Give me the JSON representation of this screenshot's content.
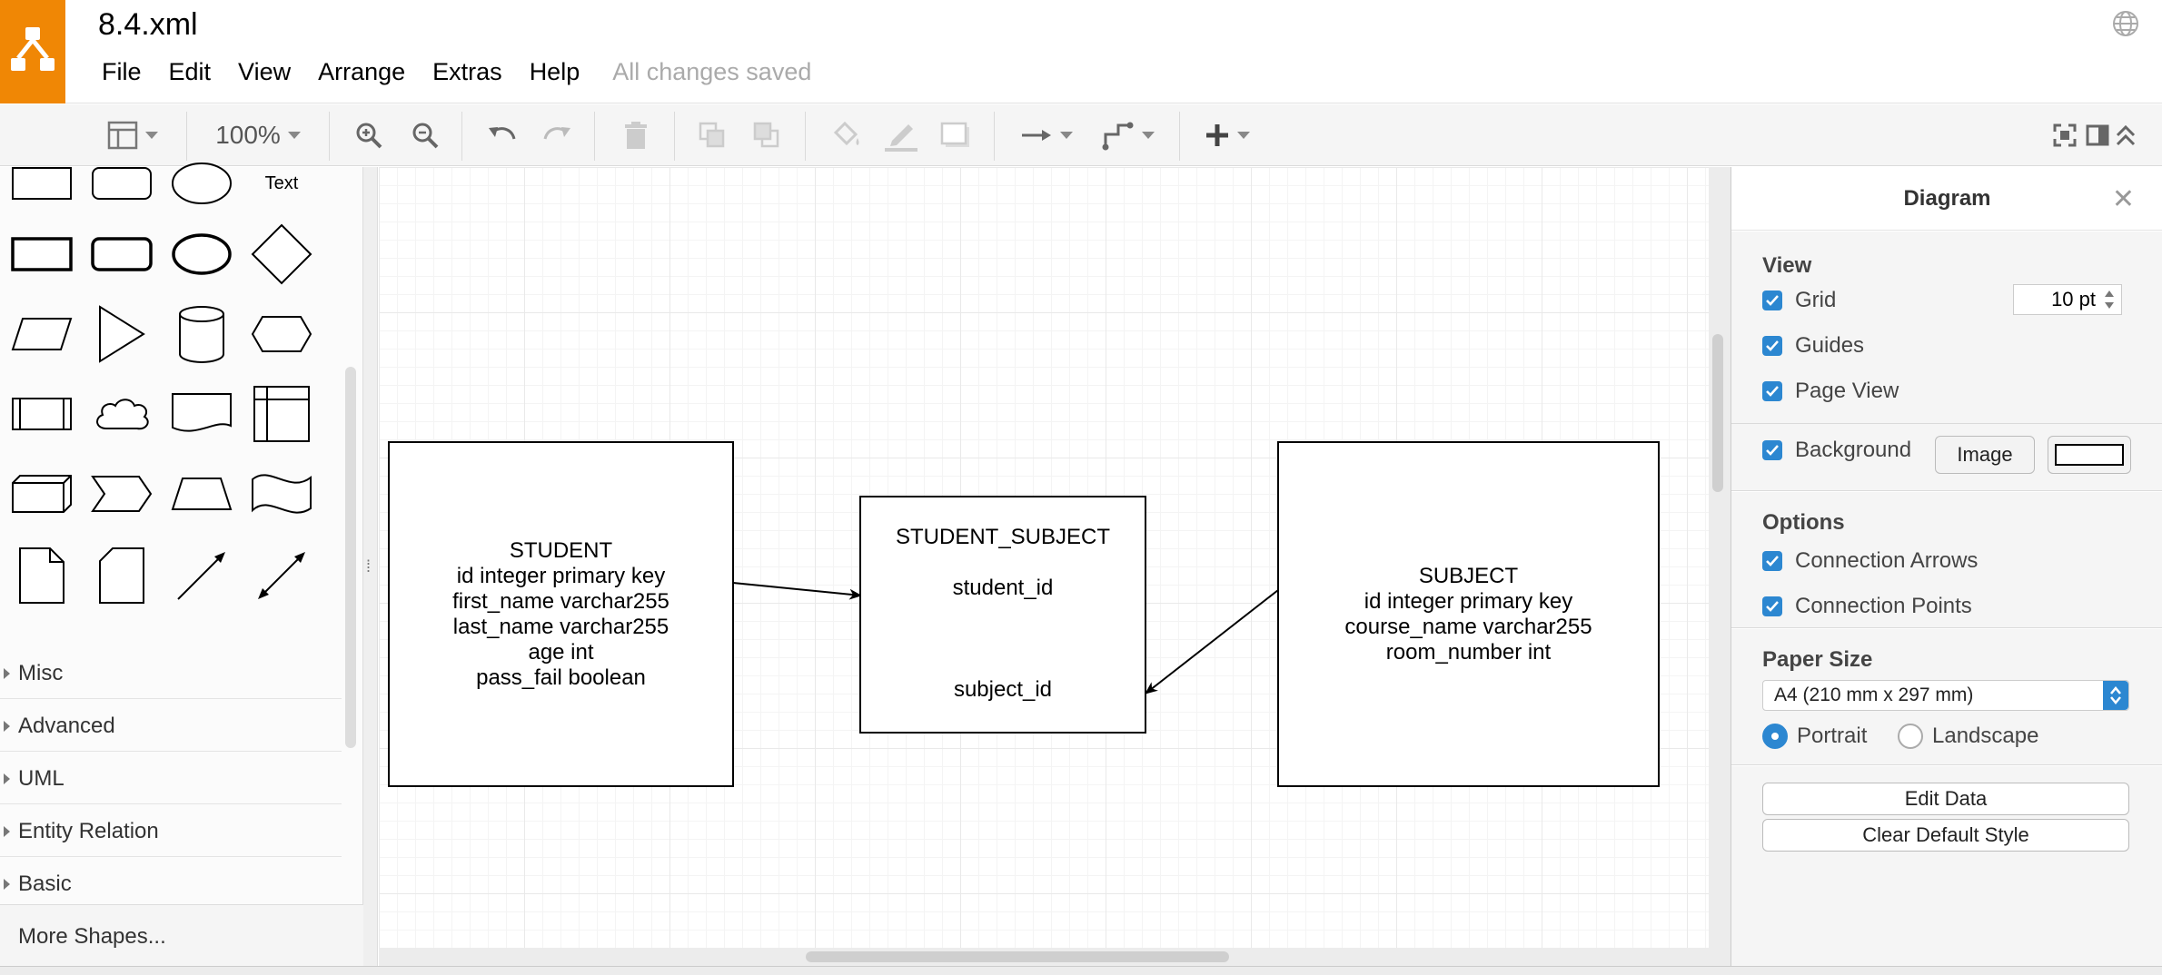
{
  "header": {
    "title": "8.4.xml",
    "menus": [
      "File",
      "Edit",
      "View",
      "Arrange",
      "Extras",
      "Help"
    ],
    "save_status": "All changes saved"
  },
  "toolbar": {
    "zoom": "100%"
  },
  "sidebar": {
    "text_shape_label": "Text",
    "palettes": [
      "Misc",
      "Advanced",
      "UML",
      "Entity Relation",
      "Basic"
    ],
    "more_shapes": "More Shapes..."
  },
  "diagram": {
    "student": {
      "lines": [
        "STUDENT",
        "id integer primary key",
        "first_name varchar255",
        "last_name varchar255",
        "age int",
        "pass_fail boolean"
      ]
    },
    "student_subject": {
      "title": "STUDENT_SUBJECT",
      "field1": "student_id",
      "field2": "subject_id"
    },
    "subject": {
      "lines": [
        "SUBJECT",
        "id integer primary key",
        "course_name varchar255",
        "room_number int"
      ]
    }
  },
  "panel": {
    "title": "Diagram",
    "view_title": "View",
    "grid_label": "Grid",
    "grid_size": "10 pt",
    "guides_label": "Guides",
    "page_view_label": "Page View",
    "background_label": "Background",
    "image_button": "Image",
    "options_title": "Options",
    "connection_arrows_label": "Connection Arrows",
    "connection_points_label": "Connection Points",
    "paper_size_title": "Paper Size",
    "paper_size": "A4 (210 mm x 297 mm)",
    "portrait_label": "Portrait",
    "landscape_label": "Landscape",
    "edit_data_button": "Edit Data",
    "clear_style_button": "Clear Default Style"
  },
  "colors": {
    "brand": "#f08705",
    "accent": "#2c87d1"
  }
}
